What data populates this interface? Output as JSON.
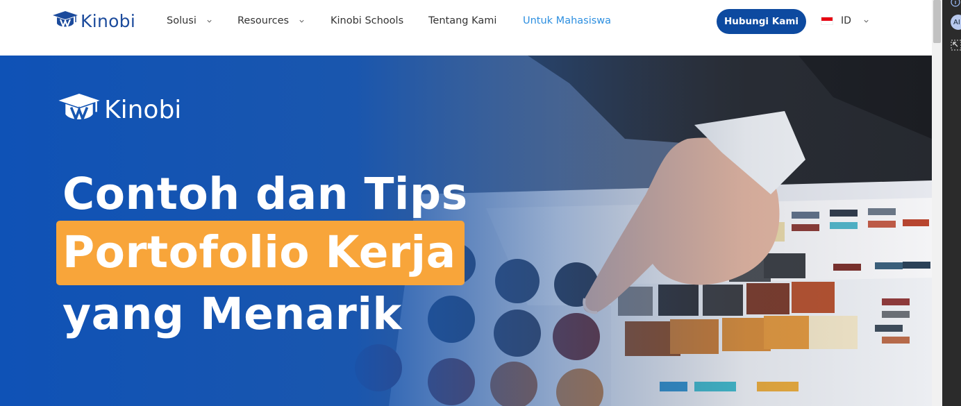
{
  "brand": {
    "name": "Kinobi",
    "color": "#1c4b9c"
  },
  "nav": {
    "items": [
      {
        "label": "Solusi",
        "dropdown": true
      },
      {
        "label": "Resources",
        "dropdown": true
      },
      {
        "label": "Kinobi Schools",
        "dropdown": false
      },
      {
        "label": "Tentang Kami",
        "dropdown": false
      },
      {
        "label": "Untuk Mahasiswa",
        "dropdown": false,
        "active": true
      }
    ],
    "contact_button": "Hubungi Kami",
    "language": {
      "code": "ID",
      "flag": "indonesia-flag-icon"
    }
  },
  "hero": {
    "logo_text": "Kinobi",
    "headline_line1": "Contoh dan Tips",
    "headline_line2": "Portofolio Kerja",
    "headline_line3": "yang Menarik",
    "highlight_color": "#f8a53a",
    "overlay_color": "#0f52b6"
  },
  "side_panel": {
    "avatar_label": "AI"
  },
  "colors": {
    "accent": "#0d4aa0",
    "active_link": "#2d8fe0"
  }
}
